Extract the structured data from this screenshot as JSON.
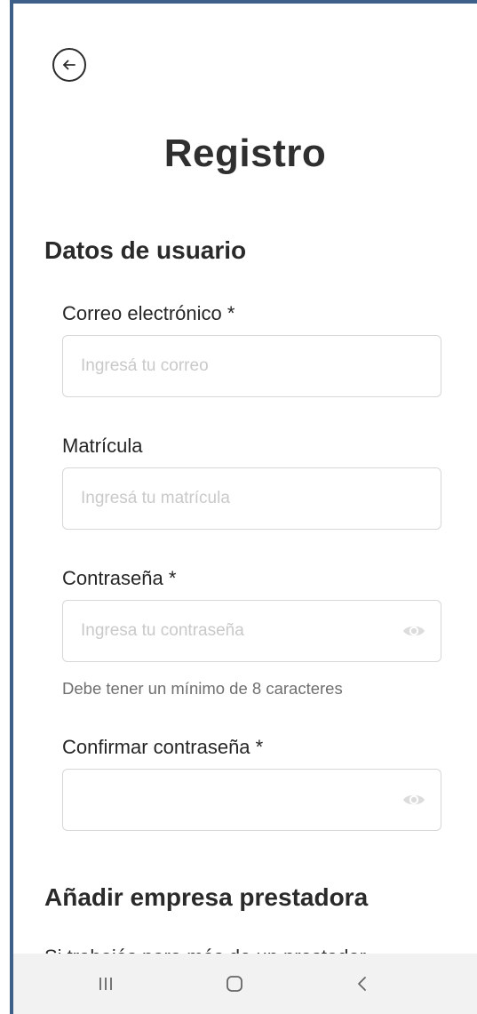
{
  "header": {
    "title": "Registro"
  },
  "sections": {
    "user_data_title": "Datos de usuario",
    "company_title": "Añadir empresa prestadora",
    "company_text": "Si trabajás para más de un prestador"
  },
  "fields": {
    "email": {
      "label": "Correo electrónico *",
      "placeholder": "Ingresá tu correo",
      "value": ""
    },
    "matricula": {
      "label": "Matrícula",
      "placeholder": "Ingresá tu matrícula",
      "value": ""
    },
    "password": {
      "label": "Contraseña *",
      "placeholder": "Ingresa tu contraseña",
      "value": "",
      "helper": "Debe tener un mínimo de 8 caracteres"
    },
    "confirm_password": {
      "label": "Confirmar contraseña *",
      "placeholder": "",
      "value": ""
    }
  },
  "icons": {
    "back": "arrow-left-circle-icon",
    "password_toggle": "eye-icon",
    "nav_recents": "recents-icon",
    "nav_home": "home-icon",
    "nav_back": "chevron-left-icon"
  },
  "colors": {
    "frame_accent": "#3d5f8a",
    "text_primary": "#2a2a2a",
    "placeholder": "#c9c9c9",
    "helper": "#6f6f6f",
    "input_border": "#d7d7d7",
    "nav_bar": "#f2f2f2"
  }
}
